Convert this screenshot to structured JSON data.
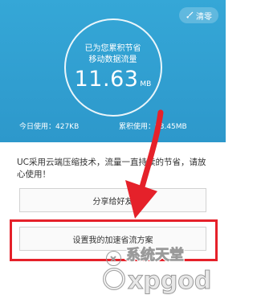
{
  "header": {
    "clean_label": "清零",
    "ring_line1": "已为您累积节省",
    "ring_line2": "移动数据流量",
    "saved_value": "11.63",
    "saved_unit": "MB",
    "today_usage": "今日使用：427KB",
    "total_usage": "累积使用：83.45MB"
  },
  "description": "UC采用云端压缩技术，流量一直持续的节省，请放心使用！",
  "buttons": {
    "share": "分享给好友",
    "setup": "设置我的加速省流方案"
  },
  "watermark_text": "系统天堂",
  "colors": {
    "header_bg": "#2d98cb",
    "highlight_red": "#e5212a"
  }
}
